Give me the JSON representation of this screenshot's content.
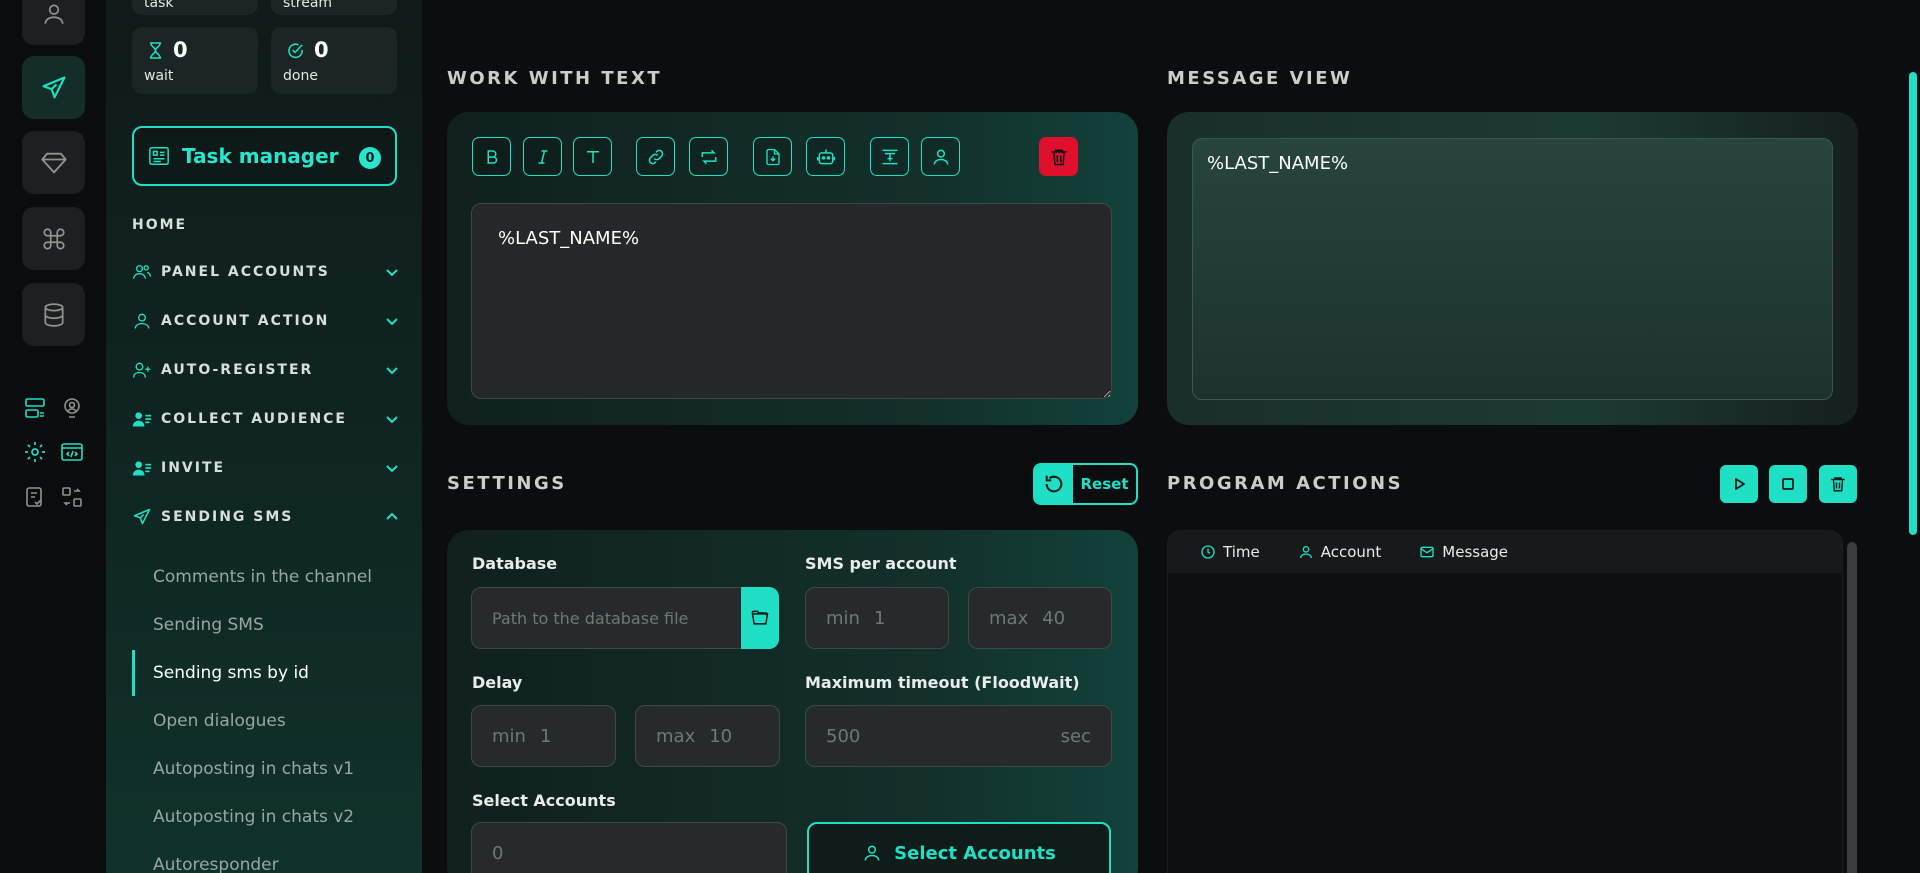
{
  "sidebar": {
    "stats_top": [
      {
        "label": "task"
      },
      {
        "label": "stream"
      }
    ],
    "stats": [
      {
        "icon": "hourglass-icon",
        "value": "0",
        "label": "wait"
      },
      {
        "icon": "check-circle-icon",
        "value": "0",
        "label": "done"
      }
    ],
    "task_manager": {
      "label": "Task manager",
      "badge": "0"
    },
    "home": "HOME",
    "nav": [
      {
        "icon": "users-icon",
        "label": "PANEL ACCOUNTS"
      },
      {
        "icon": "user-icon",
        "label": "ACCOUNT ACTION"
      },
      {
        "icon": "user-plus-icon",
        "label": "AUTO-REGISTER"
      },
      {
        "icon": "user-list-icon",
        "label": "COLLECT AUDIENCE"
      },
      {
        "icon": "user-list-icon",
        "label": "INVITE"
      },
      {
        "icon": "send-icon",
        "label": "SENDING SMS"
      }
    ],
    "sub_items": [
      "Comments in the channel",
      "Sending SMS",
      "Sending sms by id",
      "Open dialogues",
      "Autoposting in chats v1",
      "Autoposting in chats v2",
      "Autoresponder"
    ]
  },
  "work_with_text": {
    "title": "WORK WITH TEXT",
    "toolbar_icons": [
      "bold-icon",
      "italic-icon",
      "text-icon",
      "link-icon",
      "repeat-icon",
      "file-import-icon",
      "robot-icon",
      "text-format-icon",
      "user-icon",
      "trash-icon"
    ],
    "text_value": "%LAST_NAME%"
  },
  "message_view": {
    "title": "MESSAGE VIEW",
    "preview": "%LAST_NAME%"
  },
  "settings": {
    "title": "SETTINGS",
    "reset_label": "Reset",
    "database_label": "Database",
    "database_placeholder": "Path to the database file",
    "sms_per_account_label": "SMS per account",
    "sms_min_prefix": "min",
    "sms_min": "1",
    "sms_max_prefix": "max",
    "sms_max": "40",
    "delay_label": "Delay",
    "delay_min_prefix": "min",
    "delay_min": "1",
    "delay_max_prefix": "max",
    "delay_max": "10",
    "timeout_label": "Maximum timeout (FloodWait)",
    "timeout_value": "500",
    "timeout_unit": "sec",
    "select_accounts_label": "Select Accounts",
    "select_accounts_count": "0",
    "select_accounts_button": "Select Accounts"
  },
  "program_actions": {
    "title": "PROGRAM ACTIONS",
    "columns": [
      {
        "icon": "clock-icon",
        "label": "Time"
      },
      {
        "icon": "user-icon",
        "label": "Account"
      },
      {
        "icon": "mail-icon",
        "label": "Message"
      }
    ]
  },
  "colors": {
    "accent": "#1fe0c4",
    "danger": "#e0102c",
    "background": "#0c0d0e"
  }
}
